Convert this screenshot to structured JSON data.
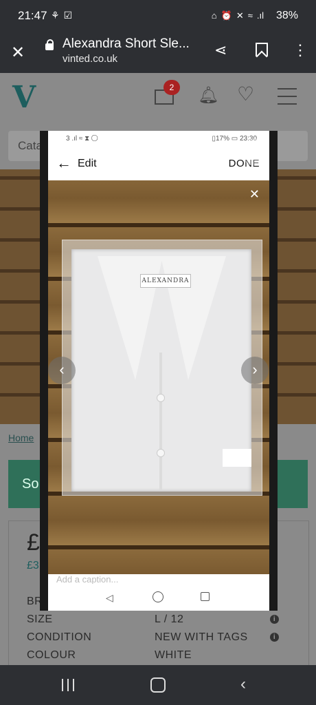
{
  "status_bar": {
    "time": "21:47",
    "battery": "38%"
  },
  "browser": {
    "title": "Alexandra Short Sle...",
    "url": "vinted.co.uk"
  },
  "page": {
    "logo": "V",
    "mail_badge": "2",
    "catalog_placeholder": "Cata",
    "breadcrumb_home": "Home",
    "sold_banner": "So",
    "price": "£",
    "price_sub": "£3",
    "details": [
      {
        "key": "BR",
        "value": ""
      },
      {
        "key": "SIZE",
        "value": "L / 12"
      },
      {
        "key": "CONDITION",
        "value": "NEW WITH TAGS"
      },
      {
        "key": "COLOUR",
        "value": "WHITE"
      }
    ]
  },
  "modal": {
    "inner_status_left": "3 .ıl ≈ ⧗ ◯",
    "inner_status_right": "▯17% ▭ 23:30",
    "edit_label": "Edit",
    "done_label": "DONE",
    "brand_tag": "ALEXANDRA",
    "caption_placeholder": "Add a caption..."
  }
}
